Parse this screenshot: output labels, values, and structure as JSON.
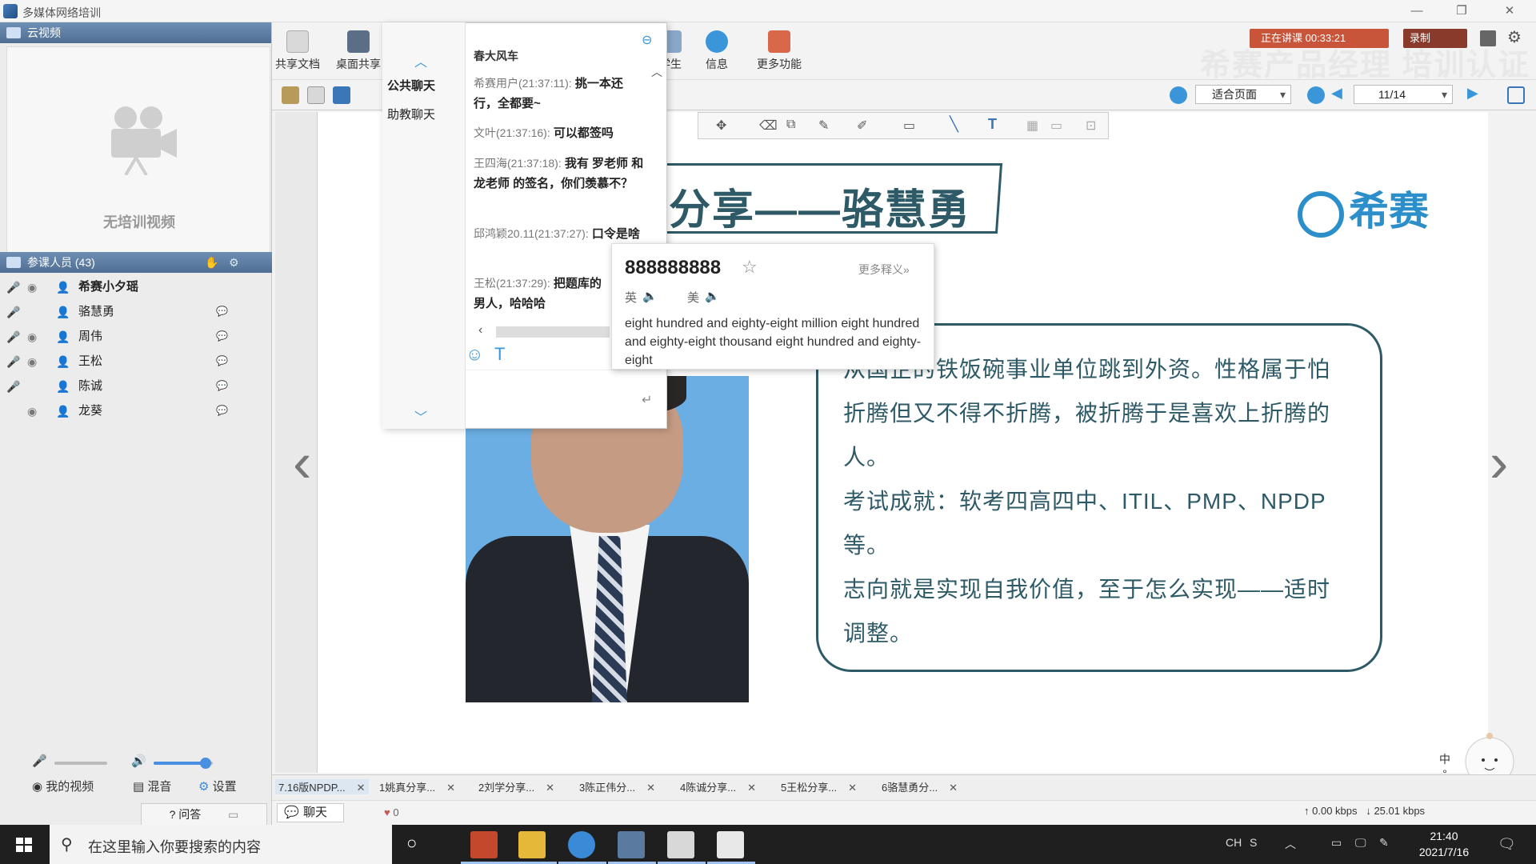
{
  "window": {
    "title": "多媒体网络培训"
  },
  "left_panel": {
    "video_header": "云视频",
    "no_video": "无培训视频",
    "participants_header": "参课人员 (43)",
    "participants": [
      {
        "name": "希赛小夕瑶",
        "bold": true
      },
      {
        "name": "骆慧勇",
        "bold": false
      },
      {
        "name": "周伟",
        "bold": false
      },
      {
        "name": "王松",
        "bold": false
      },
      {
        "name": "陈诚",
        "bold": false
      },
      {
        "name": "龙葵",
        "bold": false
      }
    ],
    "my_video": "我的视频",
    "mix": "混音",
    "settings": "设置",
    "qa": "问答"
  },
  "toolbar": {
    "share_doc": "共享文档",
    "desktop_share": "桌面共享",
    "students": "学生",
    "info": "信息",
    "more": "更多功能",
    "watermark": "希赛产品经理 培训认证",
    "speaking": "正在讲课 00:33:21",
    "record": "录制",
    "fit_page": "适合页面",
    "page": "11/14"
  },
  "chat": {
    "tab_public": "公共聊天",
    "tab_assistant": "助教聊天",
    "header": "春大风车",
    "messages": [
      {
        "who": "希赛用户(21:37:11):",
        "text": "挑一本还行，全都要~"
      },
      {
        "who": "文叶(21:37:16):",
        "text": "可以都签吗"
      },
      {
        "who": "王四海(21:37:18):",
        "text": "我有 罗老师 和 龙老师 的签名，你们羡慕不？"
      },
      {
        "who": "邱鸿颖20.11(21:37:27):",
        "text": "口令是啥"
      },
      {
        "who": "王松(21:37:29):",
        "text": "把题库的男人，哈哈哈"
      }
    ]
  },
  "dictionary": {
    "word": "888888888",
    "more": "更多释义»",
    "uk": "英",
    "us": "美",
    "definition": "eight hundred and eighty-eight million eight hundred and eighty-eight thousand eight hundred and eighty-eight"
  },
  "slide": {
    "title": "分享——骆慧勇",
    "logo": "希赛",
    "bio_lines": [
      "从国企的铁饭碗事业单位跳到外资。性格属于怕",
      "折腾但又不得不折腾，被折腾于是喜欢上折腾的",
      "人。",
      "考试成就：软考四高四中、ITIL、PMP、NPDP",
      "等。",
      "志向就是实现自我价值，至于怎么实现——适时",
      "调整。"
    ]
  },
  "doc_tabs": [
    "7.16版NPDP...",
    "1姚真分享...",
    "2刘学分享...",
    "3陈正伟分...",
    "4陈诚分享...",
    "5王松分享...",
    "6骆慧勇分..."
  ],
  "status": {
    "chat_tab": "聊天",
    "likes": "0",
    "upload": "0.00 kbps",
    "download": "25.01 kbps"
  },
  "taskbar": {
    "search_placeholder": "在这里输入你要搜索的内容",
    "ime": "CH",
    "time": "21:40",
    "date": "2021/7/16"
  },
  "colors": {
    "slide_accent": "#2d5a66",
    "logo": "#2d8fc9",
    "panel_header": "#5a7aa0"
  }
}
